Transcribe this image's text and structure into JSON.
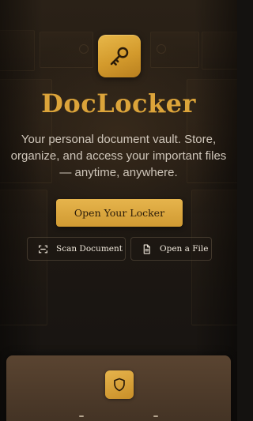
{
  "app": {
    "title": "DocLocker",
    "tagline": "Your personal document vault. Store, organize, and access your important files — anytime, anywhere.",
    "logo_icon": "key-icon"
  },
  "actions": {
    "primary_label": "Open Your Locker",
    "scan_label": "Scan Document",
    "scan_icon": "scan-icon",
    "open_file_label": "Open a File",
    "open_file_icon": "document-icon"
  },
  "feature_card": {
    "icon": "shield-icon"
  },
  "colors": {
    "accent_gold": "#dca43a",
    "button_gold": "#e0ab42",
    "background": "#1c1712",
    "text_muted": "#cfc6ba",
    "card_brown": "#4e3a2a"
  }
}
